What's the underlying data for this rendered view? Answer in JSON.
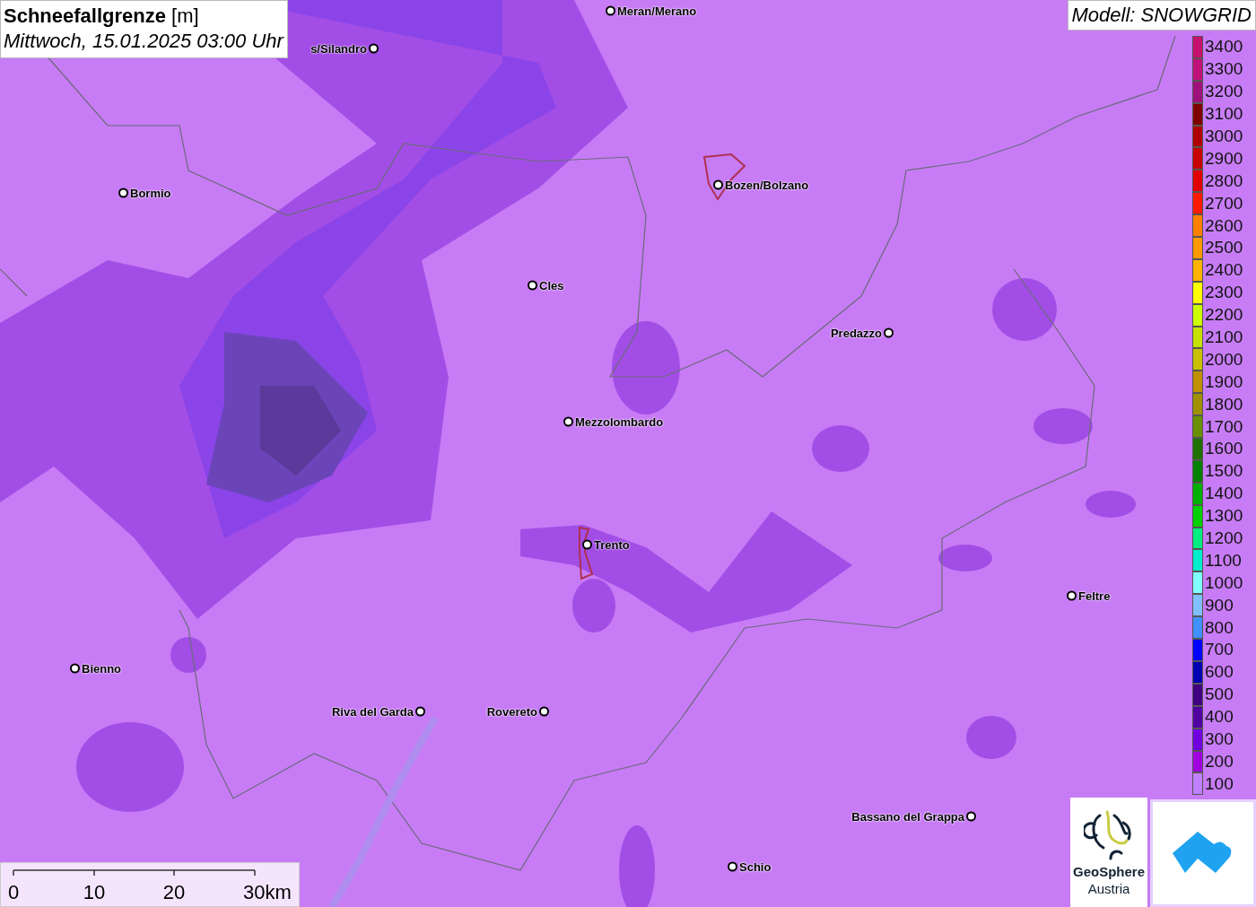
{
  "title": {
    "heading": "**Schneefallgrenze** [m]",
    "time": "Mittwoch, 15.01.2025 03:00 Uhr"
  },
  "model": "Modell: SNOWGRID",
  "cities": [
    {
      "name": "Meran/Merano"
    },
    {
      "name": "s/Silandro"
    },
    {
      "name": "Bormio"
    },
    {
      "name": "Bozen/Bolzano"
    },
    {
      "name": "Cles"
    },
    {
      "name": "Predazzo"
    },
    {
      "name": "Mezzolombardo"
    },
    {
      "name": "Trento"
    },
    {
      "name": "Feltre"
    },
    {
      "name": "Bienno"
    },
    {
      "name": "Riva del Garda"
    },
    {
      "name": "Rovereto"
    },
    {
      "name": "Bassano del Grappa"
    },
    {
      "name": "Schio"
    }
  ],
  "legend": [
    {
      "label": "3400",
      "color": "#c8106e"
    },
    {
      "label": "3300",
      "color": "#c0107a"
    },
    {
      "label": "3200",
      "color": "#a0107a"
    },
    {
      "label": "3100",
      "color": "#800000"
    },
    {
      "label": "3000",
      "color": "#b00000"
    },
    {
      "label": "2900",
      "color": "#c80000"
    },
    {
      "label": "2800",
      "color": "#e00000"
    },
    {
      "label": "2700",
      "color": "#ff1a00"
    },
    {
      "label": "2600",
      "color": "#ff8000"
    },
    {
      "label": "2500",
      "color": "#ff9900"
    },
    {
      "label": "2400",
      "color": "#ffb300"
    },
    {
      "label": "2300",
      "color": "#ffff00"
    },
    {
      "label": "2200",
      "color": "#ccff00"
    },
    {
      "label": "2100",
      "color": "#c8e000"
    },
    {
      "label": "2000",
      "color": "#c8c000"
    },
    {
      "label": "1900",
      "color": "#c09000"
    },
    {
      "label": "1800",
      "color": "#a09000"
    },
    {
      "label": "1700",
      "color": "#6a9000"
    },
    {
      "label": "1600",
      "color": "#207000"
    },
    {
      "label": "1500",
      "color": "#008000"
    },
    {
      "label": "1400",
      "color": "#00b000"
    },
    {
      "label": "1300",
      "color": "#00d000"
    },
    {
      "label": "1200",
      "color": "#00ee80"
    },
    {
      "label": "1100",
      "color": "#00eecc"
    },
    {
      "label": "1000",
      "color": "#80ffff"
    },
    {
      "label": "900",
      "color": "#80c0ff"
    },
    {
      "label": "800",
      "color": "#4090ff"
    },
    {
      "label": "700",
      "color": "#0000ff"
    },
    {
      "label": "600",
      "color": "#0000b0"
    },
    {
      "label": "500",
      "color": "#400080"
    },
    {
      "label": "400",
      "color": "#5000a0"
    },
    {
      "label": "300",
      "color": "#7000e0"
    },
    {
      "label": "200",
      "color": "#a000e0"
    },
    {
      "label": "100",
      "color": "#c080ff"
    }
  ],
  "scale": [
    "0",
    "10",
    "20",
    "30km"
  ],
  "logo": {
    "line_1": "GeoSphere",
    "line_2": "Austria"
  }
}
